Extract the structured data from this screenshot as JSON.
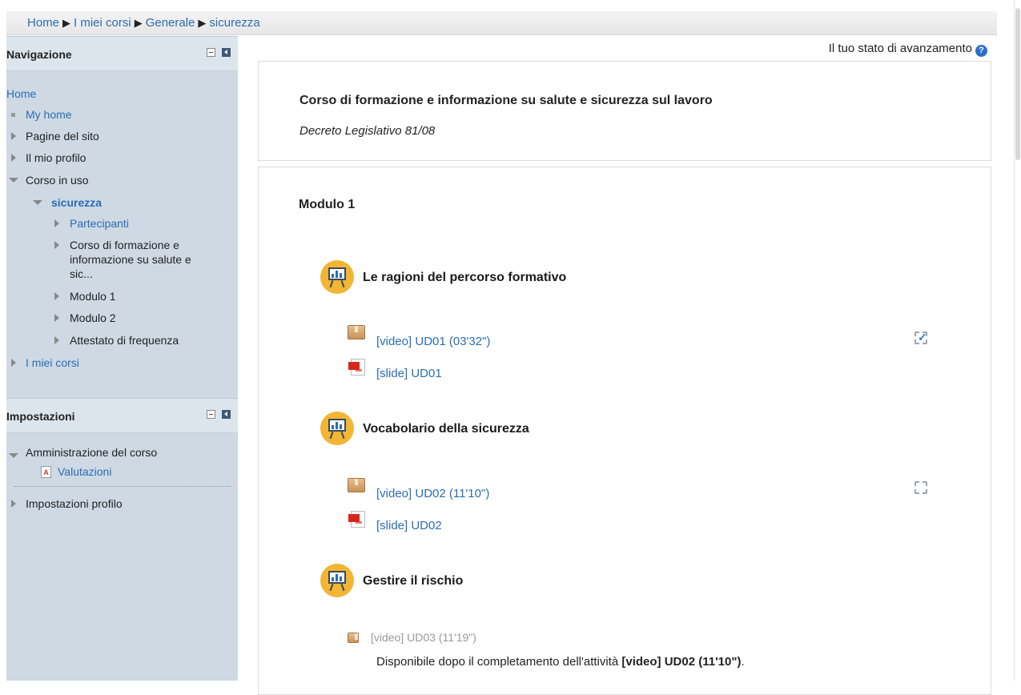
{
  "breadcrumb": {
    "items": [
      "Home",
      "I miei corsi",
      "Generale",
      "sicurezza"
    ],
    "separator": "▶"
  },
  "status": {
    "label": "Il tuo stato di avanzamento",
    "help_icon": "?"
  },
  "sidebar": {
    "navigation": {
      "title": "Navigazione",
      "home": "Home",
      "my_home": "My home",
      "site_pages": "Pagine del sito",
      "my_profile": "Il mio profilo",
      "current_course": "Corso in uso",
      "course_short": "sicurezza",
      "participants": "Partecipanti",
      "course_section_line1": "Corso di formazione e",
      "course_section_line2": "informazione su salute e",
      "course_section_line3": "sic...",
      "module1": "Modulo 1",
      "module2": "Modulo 2",
      "certificate": "Attestato di frequenza",
      "my_courses": "I miei corsi"
    },
    "settings": {
      "title": "Impostazioni",
      "course_admin": "Amministrazione del corso",
      "grades": "Valutazioni",
      "grades_icon_letter": "A",
      "profile_settings": "Impostazioni profilo"
    }
  },
  "course": {
    "title": "Corso di formazione e informazione su salute e sicurezza sul lavoro",
    "subtitle": "Decreto Legislativo 81/08"
  },
  "section": {
    "title": "Modulo 1",
    "labels": [
      {
        "title": "Le ragioni del percorso formativo",
        "video": "[video] UD01 (03'32\")",
        "slide": "[slide] UD01",
        "completed": true
      },
      {
        "title": "Vocabolario della sicurezza",
        "video": "[video] UD02 (11'10\")",
        "slide": "[slide] UD02",
        "completed": false
      },
      {
        "title": "Gestire il rischio",
        "video": "[video] UD03 (11'19\")"
      }
    ],
    "availability": {
      "prefix": "Disponibile dopo il completamento dell'attività ",
      "activity": "[video] UD02 (11'10\")",
      "suffix": "."
    }
  },
  "colors": {
    "link": "#2a6db3",
    "sidebar_bg": "#ced9e4",
    "label_icon": "#f2b534",
    "pdf": "#d9261c"
  }
}
